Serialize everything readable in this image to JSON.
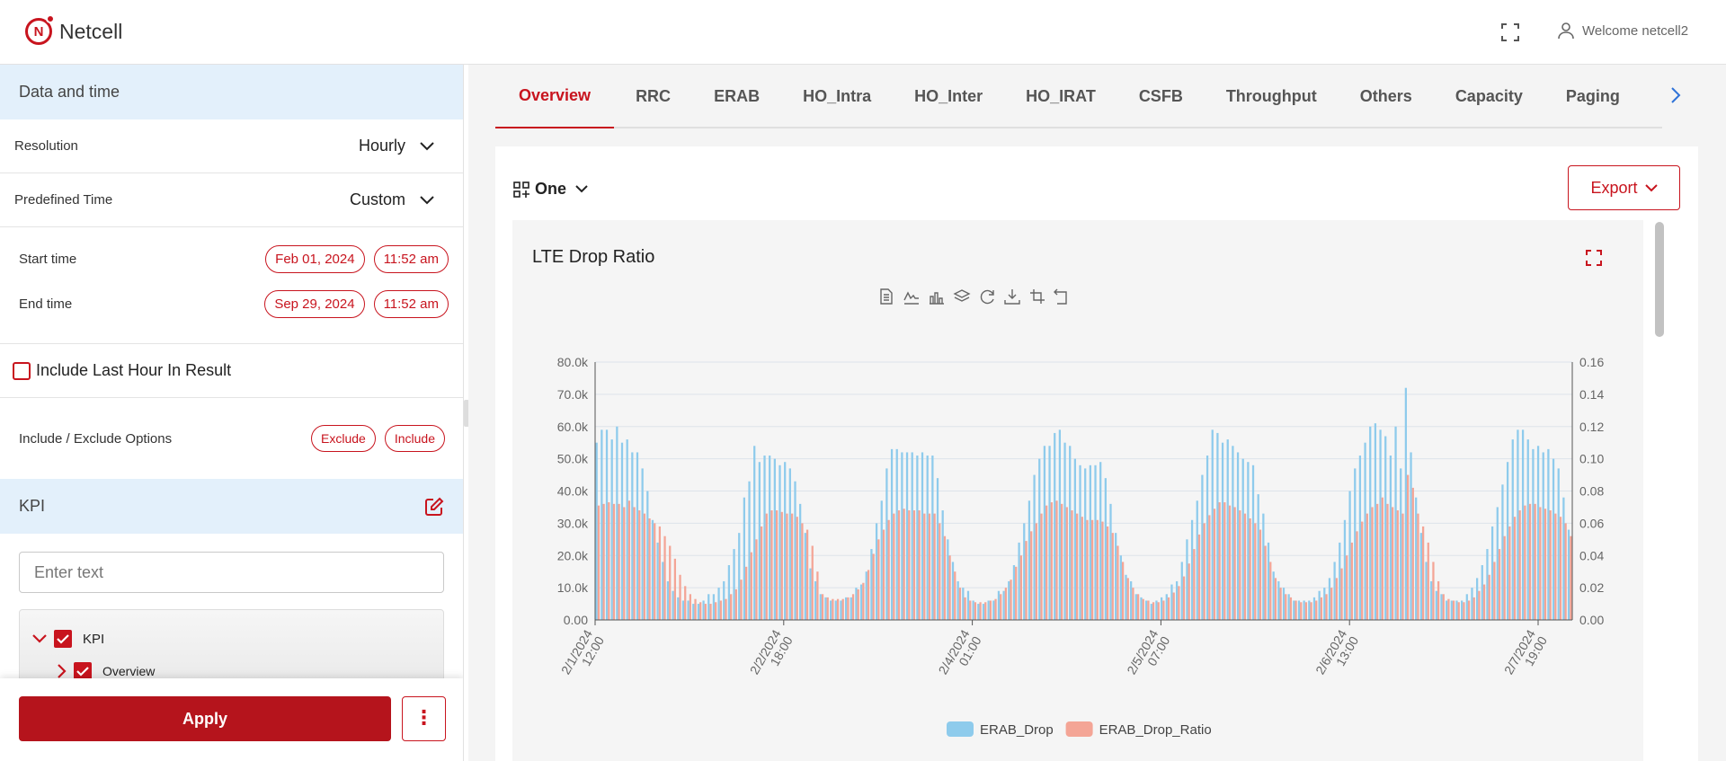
{
  "app": {
    "name": "Netcell",
    "logo_letter": "N",
    "user_welcome": "Welcome netcell2"
  },
  "sidebar": {
    "date_section_title": "Data and time",
    "resolution": {
      "label": "Resolution",
      "value": "Hourly"
    },
    "predefined_time": {
      "label": "Predefined Time",
      "value": "Custom"
    },
    "start_time": {
      "label": "Start time",
      "date": "Feb 01, 2024",
      "time": "11:52 am"
    },
    "end_time": {
      "label": "End time",
      "date": "Sep 29, 2024",
      "time": "11:52 am"
    },
    "include_last_hour": {
      "label": "Include Last Hour In Result",
      "checked": false
    },
    "include_exclude": {
      "label": "Include / Exclude Options",
      "exclude": "Exclude",
      "include": "Include"
    },
    "kpi_section_title": "KPI",
    "search_placeholder": "Enter text",
    "tree": [
      {
        "label": "KPI",
        "checked": true,
        "expanded": true
      },
      {
        "label": "Overview",
        "checked": true,
        "expanded": false
      }
    ],
    "apply_label": "Apply",
    "more_label": "⋮"
  },
  "tabs": [
    "Overview",
    "RRC",
    "ERAB",
    "HO_Intra",
    "HO_Inter",
    "HO_IRAT",
    "CSFB",
    "Throughput",
    "Others",
    "Capacity",
    "Paging"
  ],
  "active_tab": "Overview",
  "toolbar": {
    "view_label": "One",
    "export_label": "Export"
  },
  "colors": {
    "accent": "#c8141e",
    "erab_drop": "#8ecbec",
    "erab_drop_ratio": "#f4a596"
  },
  "icons": [
    "netcell-logo-icon",
    "fullscreen-icon",
    "user-icon",
    "chevron-down-icon",
    "chevron-right-icon",
    "edit-icon",
    "check-icon",
    "grid-plus-icon",
    "data-view-icon",
    "line-chart-icon",
    "bar-chart-icon",
    "stack-icon",
    "restore-icon",
    "download-icon",
    "zoom-icon",
    "zoom-reset-icon"
  ],
  "chart": {
    "title": "LTE Drop Ratio",
    "legend": [
      "ERAB_Drop",
      "ERAB_Drop_Ratio"
    ]
  },
  "chart_data": {
    "type": "bar",
    "title": "LTE Drop Ratio",
    "y_left": {
      "min": 0,
      "max": 80000,
      "ticks": [
        "0.00",
        "10.0k",
        "20.0k",
        "30.0k",
        "40.0k",
        "50.0k",
        "60.0k",
        "70.0k",
        "80.0k"
      ]
    },
    "y_right": {
      "min": 0,
      "max": 0.16,
      "ticks": [
        "0.00",
        "0.02",
        "0.04",
        "0.06",
        "0.08",
        "0.10",
        "0.12",
        "0.14",
        "0.16"
      ]
    },
    "x_ticks": [
      [
        "2/1/2024",
        "12:00"
      ],
      [
        "2/2/2024",
        "18:00"
      ],
      [
        "2/4/2024",
        "01:00"
      ],
      [
        "2/5/2024",
        "07:00"
      ],
      [
        "2/6/2024",
        "13:00"
      ],
      [
        "2/7/2024",
        "19:00"
      ]
    ],
    "grid": true,
    "legend_position": "bottom",
    "series": [
      {
        "name": "ERAB_Drop",
        "axis": "left",
        "values": [
          55000,
          59000,
          59000,
          56000,
          60000,
          55000,
          56000,
          52000,
          52000,
          47000,
          40000,
          31000,
          24000,
          18000,
          12000,
          9000,
          7000,
          6000,
          6000,
          5000,
          5000,
          6000,
          8000,
          8000,
          10000,
          12000,
          17000,
          22000,
          27000,
          38000,
          43000,
          54000,
          49000,
          51000,
          51000,
          50000,
          48000,
          49000,
          47000,
          43000,
          36000,
          27000,
          16000,
          12000,
          8000,
          7000,
          6000,
          6000,
          6000,
          7000,
          7000,
          10000,
          11000,
          15000,
          22000,
          30000,
          37000,
          47000,
          53000,
          53000,
          52000,
          52000,
          52000,
          51000,
          52000,
          51000,
          51000,
          44000,
          34000,
          25000,
          18000,
          12000,
          10000,
          9000,
          6000,
          5000,
          5000,
          6000,
          6000,
          9000,
          9000,
          12000,
          17000,
          24000,
          30000,
          37000,
          45000,
          50000,
          54000,
          54000,
          58000,
          59000,
          55000,
          54000,
          50000,
          48000,
          47000,
          48000,
          48000,
          49000,
          44000,
          36000,
          27000,
          20000,
          14000,
          12000,
          8000,
          7000,
          6000,
          5000,
          6000,
          7000,
          8000,
          11000,
          12000,
          18000,
          25000,
          31000,
          37000,
          45000,
          51000,
          59000,
          58000,
          55000,
          56000,
          54000,
          52000,
          50000,
          49000,
          48000,
          39000,
          33000,
          24000,
          15000,
          12000,
          10000,
          8000,
          6000,
          6000,
          6000,
          6000,
          7000,
          9000,
          10000,
          13000,
          18000,
          24000,
          31000,
          40000,
          47000,
          51000,
          55000,
          60000,
          61000,
          59000,
          57000,
          51000,
          60000,
          47000,
          72000,
          52000,
          38000,
          27000,
          18000,
          12000,
          9000,
          8000,
          6000,
          6000,
          6000,
          6000,
          8000,
          10000,
          13000,
          17000,
          22000,
          29000,
          35000,
          42000,
          49000,
          56000,
          59000,
          59000,
          56000,
          53000,
          54000,
          52000,
          53000,
          50000,
          47000,
          38000,
          28000
        ]
      },
      {
        "name": "ERAB_Drop_Ratio",
        "axis": "right",
        "values": [
          0.071,
          0.072,
          0.073,
          0.072,
          0.072,
          0.07,
          0.074,
          0.07,
          0.068,
          0.066,
          0.063,
          0.06,
          0.058,
          0.052,
          0.046,
          0.038,
          0.028,
          0.021,
          0.016,
          0.013,
          0.011,
          0.01,
          0.01,
          0.011,
          0.012,
          0.013,
          0.016,
          0.019,
          0.025,
          0.033,
          0.042,
          0.05,
          0.058,
          0.066,
          0.068,
          0.068,
          0.067,
          0.066,
          0.066,
          0.064,
          0.06,
          0.056,
          0.046,
          0.03,
          0.016,
          0.014,
          0.013,
          0.013,
          0.013,
          0.014,
          0.016,
          0.019,
          0.023,
          0.031,
          0.041,
          0.05,
          0.056,
          0.062,
          0.066,
          0.068,
          0.069,
          0.068,
          0.068,
          0.068,
          0.066,
          0.066,
          0.066,
          0.06,
          0.052,
          0.04,
          0.03,
          0.02,
          0.014,
          0.012,
          0.011,
          0.011,
          0.011,
          0.012,
          0.013,
          0.016,
          0.02,
          0.025,
          0.033,
          0.04,
          0.049,
          0.055,
          0.06,
          0.066,
          0.071,
          0.073,
          0.074,
          0.072,
          0.07,
          0.068,
          0.066,
          0.064,
          0.062,
          0.062,
          0.062,
          0.061,
          0.058,
          0.054,
          0.046,
          0.036,
          0.026,
          0.02,
          0.016,
          0.013,
          0.012,
          0.011,
          0.011,
          0.012,
          0.014,
          0.017,
          0.021,
          0.027,
          0.035,
          0.044,
          0.053,
          0.06,
          0.065,
          0.069,
          0.073,
          0.073,
          0.071,
          0.07,
          0.068,
          0.066,
          0.063,
          0.06,
          0.056,
          0.046,
          0.036,
          0.026,
          0.02,
          0.016,
          0.014,
          0.012,
          0.011,
          0.011,
          0.011,
          0.012,
          0.014,
          0.016,
          0.02,
          0.026,
          0.032,
          0.04,
          0.048,
          0.055,
          0.061,
          0.066,
          0.07,
          0.072,
          0.076,
          0.072,
          0.07,
          0.068,
          0.066,
          0.09,
          0.082,
          0.066,
          0.058,
          0.048,
          0.036,
          0.024,
          0.016,
          0.013,
          0.012,
          0.011,
          0.011,
          0.012,
          0.014,
          0.018,
          0.022,
          0.028,
          0.036,
          0.044,
          0.052,
          0.058,
          0.064,
          0.068,
          0.071,
          0.072,
          0.072,
          0.07,
          0.069,
          0.068,
          0.066,
          0.064,
          0.06,
          0.052,
          0.038
        ]
      }
    ]
  }
}
